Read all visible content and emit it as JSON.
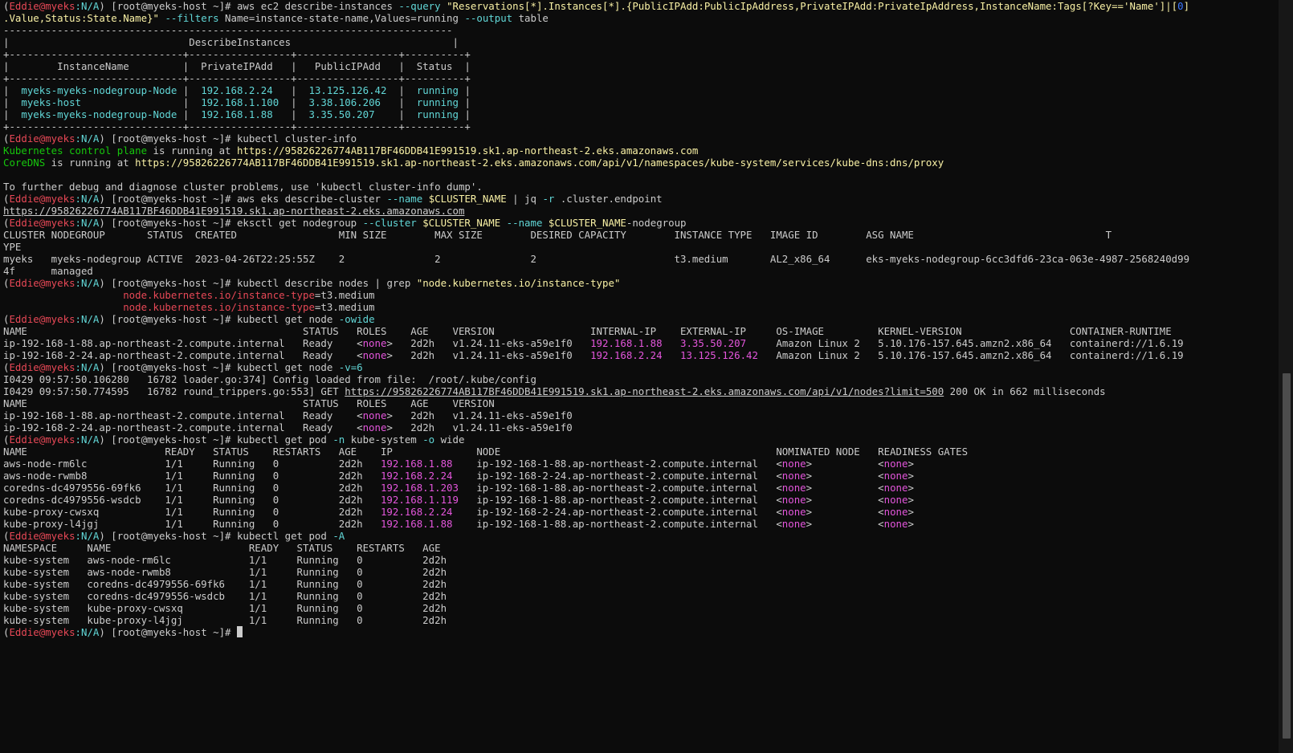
{
  "colors": {
    "default": "#cccccc",
    "red": "#e74856",
    "green": "#16c60c",
    "yellow": "#f9f1a5",
    "blue": "#3b78ff",
    "cyan": "#61d6d6",
    "magenta": "#e456dc",
    "link": "#cccccc"
  },
  "lines": [
    [
      [
        "(",
        "d"
      ],
      [
        "Eddie@myeks",
        "red"
      ],
      [
        ":N/A",
        "cyan"
      ],
      [
        ") [root@myeks-host ~]# aws ec2 describe-instances ",
        "d"
      ],
      [
        "--query",
        "cyan"
      ],
      [
        " ",
        "d"
      ],
      [
        "\"Reservations[*].Instances[*].{PublicIPAdd:PublicIpAddress,PrivateIPAdd:PrivateIpAddress,InstanceName:Tags[?Key=='Name']|[",
        "yellow"
      ],
      [
        "0",
        "blue"
      ],
      [
        "]",
        "yellow"
      ]
    ],
    [
      [
        ".Value,Status:State.Name}\"",
        "yellow"
      ],
      [
        " ",
        "d"
      ],
      [
        "--filters",
        "cyan"
      ],
      [
        " Name=instance-state-name,Values=running ",
        "d"
      ],
      [
        "--output",
        "cyan"
      ],
      [
        " table",
        "d"
      ]
    ],
    [
      [
        "---------------------------------------------------------------------------",
        "d"
      ]
    ],
    [
      [
        "|                              DescribeInstances                           |",
        "d"
      ]
    ],
    [
      [
        "+-----------------------------+-----------------+-----------------+----------+",
        "d"
      ]
    ],
    [
      [
        "|        InstanceName         |  PrivateIPAdd   |   PublicIPAdd   |  Status  |",
        "d"
      ]
    ],
    [
      [
        "+-----------------------------+-----------------+-----------------+----------+",
        "d"
      ]
    ],
    [
      [
        "|  ",
        "d"
      ],
      [
        "myeks-myeks-nodegroup-Node",
        "cyan"
      ],
      [
        " |  ",
        "d"
      ],
      [
        "192.168.2.24",
        "cyan"
      ],
      [
        "   |  ",
        "d"
      ],
      [
        "13.125.126.42",
        "cyan"
      ],
      [
        "  |  ",
        "d"
      ],
      [
        "running",
        "cyan"
      ],
      [
        " |",
        "d"
      ]
    ],
    [
      [
        "|  ",
        "d"
      ],
      [
        "myeks-host",
        "cyan"
      ],
      [
        "                 |  ",
        "d"
      ],
      [
        "192.168.1.100",
        "cyan"
      ],
      [
        "  |  ",
        "d"
      ],
      [
        "3.38.106.206",
        "cyan"
      ],
      [
        "   |  ",
        "d"
      ],
      [
        "running",
        "cyan"
      ],
      [
        " |",
        "d"
      ]
    ],
    [
      [
        "|  ",
        "d"
      ],
      [
        "myeks-myeks-nodegroup-Node",
        "cyan"
      ],
      [
        " |  ",
        "d"
      ],
      [
        "192.168.1.88",
        "cyan"
      ],
      [
        "   |  ",
        "d"
      ],
      [
        "3.35.50.207",
        "cyan"
      ],
      [
        "    |  ",
        "d"
      ],
      [
        "running",
        "cyan"
      ],
      [
        " |",
        "d"
      ]
    ],
    [
      [
        "+-----------------------------+-----------------+-----------------+----------+",
        "d"
      ]
    ],
    [
      [
        "(",
        "d"
      ],
      [
        "Eddie@myeks",
        "red"
      ],
      [
        ":N/A",
        "cyan"
      ],
      [
        ") [root@myeks-host ~]# kubectl cluster-info",
        "d"
      ]
    ],
    [
      [
        "Kubernetes control plane",
        "green"
      ],
      [
        " is running at ",
        "d"
      ],
      [
        "https://95826226774AB117BF46DDB41E991519.sk1.ap-northeast-2.eks.amazonaws.com",
        "yellow"
      ]
    ],
    [
      [
        "CoreDNS",
        "green"
      ],
      [
        " is running at ",
        "d"
      ],
      [
        "https://95826226774AB117BF46DDB41E991519.sk1.ap-northeast-2.eks.amazonaws.com/api/v1/namespaces/kube-system/services/kube-dns:dns/proxy",
        "yellow"
      ]
    ],
    [
      [
        "",
        "d"
      ]
    ],
    [
      [
        "To further debug and diagnose cluster problems, use 'kubectl cluster-info dump'.",
        "d"
      ]
    ],
    [
      [
        "(",
        "d"
      ],
      [
        "Eddie@myeks",
        "red"
      ],
      [
        ":N/A",
        "cyan"
      ],
      [
        ") [root@myeks-host ~]# aws eks describe-cluster ",
        "d"
      ],
      [
        "--name",
        "cyan"
      ],
      [
        " ",
        "d"
      ],
      [
        "$CLUSTER_NAME",
        "yellow"
      ],
      [
        " | jq ",
        "d"
      ],
      [
        "-r",
        "cyan"
      ],
      [
        " .cluster.endpoint",
        "d"
      ]
    ],
    [
      [
        "https://95826226774AB117BF46DDB41E991519.sk1.ap-northeast-2.eks.amazonaws.com",
        "link"
      ]
    ],
    [
      [
        "(",
        "d"
      ],
      [
        "Eddie@myeks",
        "red"
      ],
      [
        ":N/A",
        "cyan"
      ],
      [
        ") [root@myeks-host ~]# eksctl get nodegroup ",
        "d"
      ],
      [
        "--cluster",
        "cyan"
      ],
      [
        " ",
        "d"
      ],
      [
        "$CLUSTER_NAME",
        "yellow"
      ],
      [
        " ",
        "d"
      ],
      [
        "--name",
        "cyan"
      ],
      [
        " ",
        "d"
      ],
      [
        "$CLUSTER_NAME",
        "yellow"
      ],
      [
        "-nodegroup",
        "d"
      ]
    ],
    [
      [
        "CLUSTER NODEGROUP       STATUS  CREATED                 MIN SIZE        MAX SIZE        DESIRED CAPACITY        INSTANCE TYPE   IMAGE ID        ASG NAME                                T",
        "d"
      ]
    ],
    [
      [
        "YPE",
        "d"
      ]
    ],
    [
      [
        "myeks   myeks-nodegroup ACTIVE  2023-04-26T22:25:55Z    2               2               2                       t3.medium       AL2_x86_64      eks-myeks-nodegroup-6cc3dfd6-23ca-063e-4987-2568240d99",
        "d"
      ]
    ],
    [
      [
        "4f      managed",
        "d"
      ]
    ],
    [
      [
        "(",
        "d"
      ],
      [
        "Eddie@myeks",
        "red"
      ],
      [
        ":N/A",
        "cyan"
      ],
      [
        ") [root@myeks-host ~]# kubectl describe nodes | grep ",
        "d"
      ],
      [
        "\"node.kubernetes.io/instance-type\"",
        "yellow"
      ]
    ],
    [
      [
        "                    ",
        "d"
      ],
      [
        "node.kubernetes.io/instance-type",
        "red"
      ],
      [
        "=t3.medium",
        "d"
      ]
    ],
    [
      [
        "                    ",
        "d"
      ],
      [
        "node.kubernetes.io/instance-type",
        "red"
      ],
      [
        "=t3.medium",
        "d"
      ]
    ],
    [
      [
        "(",
        "d"
      ],
      [
        "Eddie@myeks",
        "red"
      ],
      [
        ":N/A",
        "cyan"
      ],
      [
        ") [root@myeks-host ~]# kubectl get node ",
        "d"
      ],
      [
        "-owide",
        "cyan"
      ]
    ],
    [
      [
        "NAME                                              STATUS   ROLES    AGE    VERSION                INTERNAL-IP    EXTERNAL-IP     OS-IMAGE         KERNEL-VERSION                  CONTAINER-RUNTIME",
        "d"
      ]
    ],
    [
      [
        "ip-192-168-1-88.ap-northeast-2.compute.internal   Ready    <",
        "d"
      ],
      [
        "none",
        "magenta"
      ],
      [
        ">   2d2h   v1.24.11-eks-a59e1f0   ",
        "d"
      ],
      [
        "192.168.1.88",
        "magenta"
      ],
      [
        "   ",
        "d"
      ],
      [
        "3.35.50.207",
        "magenta"
      ],
      [
        "     Amazon Linux 2   5.10.176-157.645.amzn2.x86_64   containerd://1.6.19",
        "d"
      ]
    ],
    [
      [
        "ip-192-168-2-24.ap-northeast-2.compute.internal   Ready    <",
        "d"
      ],
      [
        "none",
        "magenta"
      ],
      [
        ">   2d2h   v1.24.11-eks-a59e1f0   ",
        "d"
      ],
      [
        "192.168.2.24",
        "magenta"
      ],
      [
        "   ",
        "d"
      ],
      [
        "13.125.126.42",
        "magenta"
      ],
      [
        "   Amazon Linux 2   5.10.176-157.645.amzn2.x86_64   containerd://1.6.19",
        "d"
      ]
    ],
    [
      [
        "(",
        "d"
      ],
      [
        "Eddie@myeks",
        "red"
      ],
      [
        ":N/A",
        "cyan"
      ],
      [
        ") [root@myeks-host ~]# kubectl get node ",
        "d"
      ],
      [
        "-v=6",
        "cyan"
      ]
    ],
    [
      [
        "I0429 09:57:50.106280   16782 loader.go:374] Config loaded from file:  /root/.kube/config",
        "d"
      ]
    ],
    [
      [
        "I0429 09:57:50.774595   16782 round_trippers.go:553] GET ",
        "d"
      ],
      [
        "https://95826226774AB117BF46DDB41E991519.sk1.ap-northeast-2.eks.amazonaws.com/api/v1/nodes?limit=500",
        "link"
      ],
      [
        " 200 OK in 662 milliseconds",
        "d"
      ]
    ],
    [
      [
        "NAME                                              STATUS   ROLES    AGE    VERSION",
        "d"
      ]
    ],
    [
      [
        "ip-192-168-1-88.ap-northeast-2.compute.internal   Ready    <",
        "d"
      ],
      [
        "none",
        "magenta"
      ],
      [
        ">   2d2h   v1.24.11-eks-a59e1f0",
        "d"
      ]
    ],
    [
      [
        "ip-192-168-2-24.ap-northeast-2.compute.internal   Ready    <",
        "d"
      ],
      [
        "none",
        "magenta"
      ],
      [
        ">   2d2h   v1.24.11-eks-a59e1f0",
        "d"
      ]
    ],
    [
      [
        "(",
        "d"
      ],
      [
        "Eddie@myeks",
        "red"
      ],
      [
        ":N/A",
        "cyan"
      ],
      [
        ") [root@myeks-host ~]# kubectl get pod ",
        "d"
      ],
      [
        "-n",
        "cyan"
      ],
      [
        " kube-system ",
        "d"
      ],
      [
        "-o",
        "cyan"
      ],
      [
        " wide",
        "d"
      ]
    ],
    [
      [
        "NAME                       READY   STATUS    RESTARTS   AGE    IP              NODE                                              NOMINATED NODE   READINESS GATES",
        "d"
      ]
    ],
    [
      [
        "aws-node-rm6lc             1/1     Running   0          2d2h   ",
        "d"
      ],
      [
        "192.168.1.88",
        "magenta"
      ],
      [
        "    ip-192-168-1-88.ap-northeast-2.compute.internal   <",
        "d"
      ],
      [
        "none",
        "magenta"
      ],
      [
        ">           <",
        "d"
      ],
      [
        "none",
        "magenta"
      ],
      [
        ">",
        "d"
      ]
    ],
    [
      [
        "aws-node-rwmb8             1/1     Running   0          2d2h   ",
        "d"
      ],
      [
        "192.168.2.24",
        "magenta"
      ],
      [
        "    ip-192-168-2-24.ap-northeast-2.compute.internal   <",
        "d"
      ],
      [
        "none",
        "magenta"
      ],
      [
        ">           <",
        "d"
      ],
      [
        "none",
        "magenta"
      ],
      [
        ">",
        "d"
      ]
    ],
    [
      [
        "coredns-dc4979556-69fk6    1/1     Running   0          2d2h   ",
        "d"
      ],
      [
        "192.168.1.203",
        "magenta"
      ],
      [
        "   ip-192-168-1-88.ap-northeast-2.compute.internal   <",
        "d"
      ],
      [
        "none",
        "magenta"
      ],
      [
        ">           <",
        "d"
      ],
      [
        "none",
        "magenta"
      ],
      [
        ">",
        "d"
      ]
    ],
    [
      [
        "coredns-dc4979556-wsdcb    1/1     Running   0          2d2h   ",
        "d"
      ],
      [
        "192.168.1.119",
        "magenta"
      ],
      [
        "   ip-192-168-1-88.ap-northeast-2.compute.internal   <",
        "d"
      ],
      [
        "none",
        "magenta"
      ],
      [
        ">           <",
        "d"
      ],
      [
        "none",
        "magenta"
      ],
      [
        ">",
        "d"
      ]
    ],
    [
      [
        "kube-proxy-cwsxq           1/1     Running   0          2d2h   ",
        "d"
      ],
      [
        "192.168.2.24",
        "magenta"
      ],
      [
        "    ip-192-168-2-24.ap-northeast-2.compute.internal   <",
        "d"
      ],
      [
        "none",
        "magenta"
      ],
      [
        ">           <",
        "d"
      ],
      [
        "none",
        "magenta"
      ],
      [
        ">",
        "d"
      ]
    ],
    [
      [
        "kube-proxy-l4jgj           1/1     Running   0          2d2h   ",
        "d"
      ],
      [
        "192.168.1.88",
        "magenta"
      ],
      [
        "    ip-192-168-1-88.ap-northeast-2.compute.internal   <",
        "d"
      ],
      [
        "none",
        "magenta"
      ],
      [
        ">           <",
        "d"
      ],
      [
        "none",
        "magenta"
      ],
      [
        ">",
        "d"
      ]
    ],
    [
      [
        "(",
        "d"
      ],
      [
        "Eddie@myeks",
        "red"
      ],
      [
        ":N/A",
        "cyan"
      ],
      [
        ") [root@myeks-host ~]# kubectl get pod ",
        "d"
      ],
      [
        "-A",
        "cyan"
      ]
    ],
    [
      [
        "NAMESPACE     NAME                       READY   STATUS    RESTARTS   AGE",
        "d"
      ]
    ],
    [
      [
        "kube-system   aws-node-rm6lc             1/1     Running   0          2d2h",
        "d"
      ]
    ],
    [
      [
        "kube-system   aws-node-rwmb8             1/1     Running   0          2d2h",
        "d"
      ]
    ],
    [
      [
        "kube-system   coredns-dc4979556-69fk6    1/1     Running   0          2d2h",
        "d"
      ]
    ],
    [
      [
        "kube-system   coredns-dc4979556-wsdcb    1/1     Running   0          2d2h",
        "d"
      ]
    ],
    [
      [
        "kube-system   kube-proxy-cwsxq           1/1     Running   0          2d2h",
        "d"
      ]
    ],
    [
      [
        "kube-system   kube-proxy-l4jgj           1/1     Running   0          2d2h",
        "d"
      ]
    ],
    [
      [
        "(",
        "d"
      ],
      [
        "Eddie@myeks",
        "red"
      ],
      [
        ":N/A",
        "cyan"
      ],
      [
        ") [root@myeks-host ~]# ",
        "d"
      ]
    ]
  ]
}
